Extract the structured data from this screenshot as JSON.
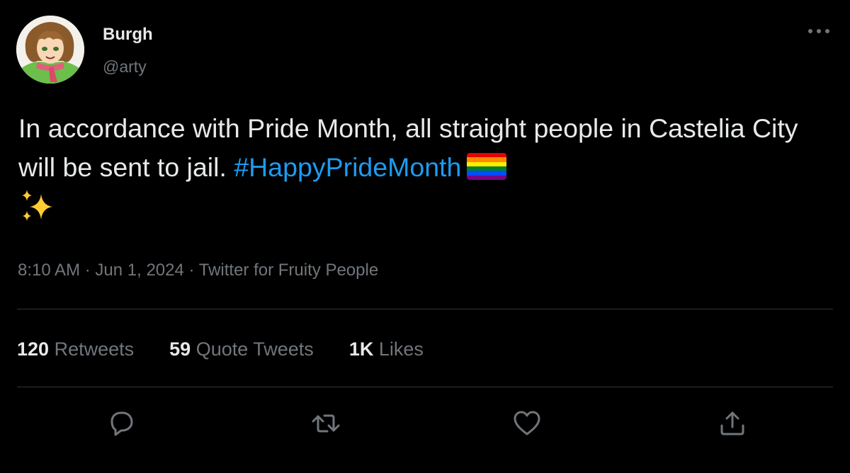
{
  "author": {
    "display_name": "Burgh",
    "handle": "@arty"
  },
  "tweet": {
    "text_before": "In accordance with Pride Month, all straight people in Castelia City will be sent to jail. ",
    "hashtag": "#HappyPrideMonth",
    "emojis": [
      "rainbow-flag",
      "sparkles"
    ]
  },
  "meta": {
    "time": "8:10 AM",
    "separator": "·",
    "date": "Jun 1, 2024",
    "source": "Twitter for Fruity People"
  },
  "stats": {
    "retweets": {
      "count": "120",
      "label": "Retweets"
    },
    "quotes": {
      "count": "59",
      "label": "Quote Tweets"
    },
    "likes": {
      "count": "1K",
      "label": "Likes"
    }
  },
  "actions": [
    "reply-icon",
    "retweet-icon",
    "like-icon",
    "share-icon"
  ],
  "colors": {
    "background": "#000000",
    "text": "#e7e9ea",
    "secondary": "#71767b",
    "link": "#1d9bf0",
    "divider": "#2f3336"
  }
}
